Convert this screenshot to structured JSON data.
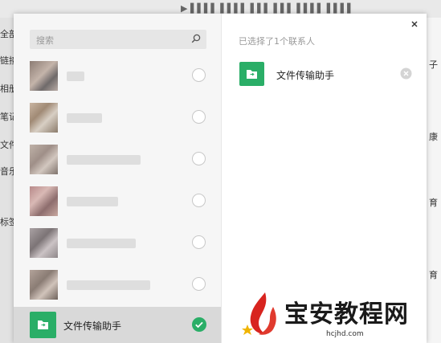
{
  "background": {
    "top_text": "▶ ▌▌▌▌ ▌▌▌▌ ▌▌▌ ▌▌▌ ▌▌▌▌ ▌▌▌▌",
    "left_labels": [
      "全部",
      "链接",
      "相册",
      "笔记",
      "文件",
      "音乐",
      "标签"
    ],
    "right_labels": [
      "子",
      "康",
      "育",
      "育"
    ]
  },
  "dialog": {
    "search": {
      "placeholder": "搜索",
      "icon": "search-icon"
    },
    "contacts_count": 6,
    "selected_contact": {
      "name": "文件传输助手",
      "icon": "folder-icon",
      "checked": true
    },
    "selection_header": "已选择了1个联系人",
    "chosen": [
      {
        "name": "文件传输助手",
        "icon": "folder-icon"
      }
    ],
    "close_icon": "close-icon"
  },
  "watermark": {
    "brand": "宝安教程网",
    "site": "hcjhd.com"
  },
  "colors": {
    "accent_green": "#2aae67",
    "selected_row_bg": "#d9d9d9",
    "left_pane_bg": "#f6f6f6"
  }
}
